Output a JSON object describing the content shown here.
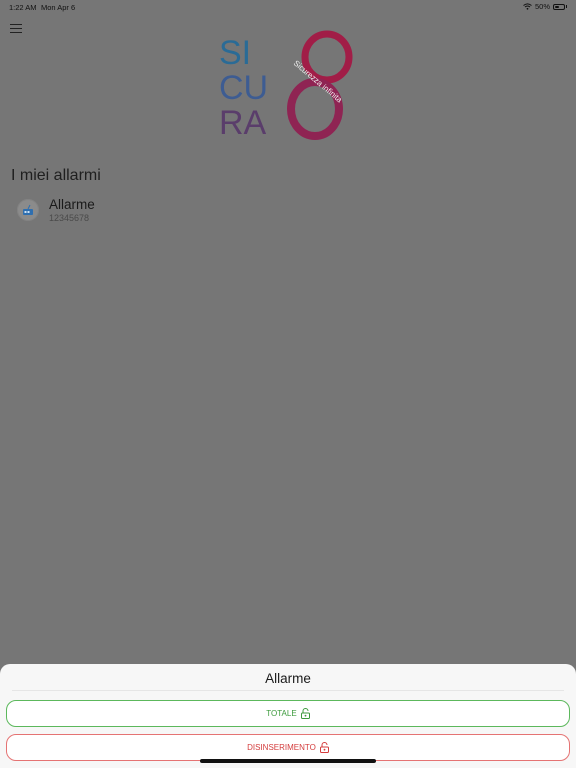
{
  "status_bar": {
    "time": "1:22 AM",
    "date": "Mon Apr 6",
    "battery": "50%",
    "battery_level": 0.5
  },
  "logo": {
    "letters": [
      "SI",
      "CU",
      "RA"
    ],
    "number": "8",
    "tagline": "Sicurezza infinita",
    "colors": {
      "si": "#2a6b96",
      "cu": "#3d5c92",
      "ra": "#5a3d6b",
      "eight": "#a11d47"
    }
  },
  "main": {
    "section_title": "I miei allarmi",
    "alarms": [
      {
        "name": "Allarme",
        "code": "12345678",
        "icon": "alarm-panel-icon"
      }
    ]
  },
  "sheet": {
    "title": "Allarme",
    "buttons": [
      {
        "label": "TOTALE",
        "icon": "lock-open-icon",
        "color": "#3c9a3c"
      },
      {
        "label": "DISINSERIMENTO",
        "icon": "lock-open-icon",
        "color": "#d43c3c"
      }
    ]
  }
}
